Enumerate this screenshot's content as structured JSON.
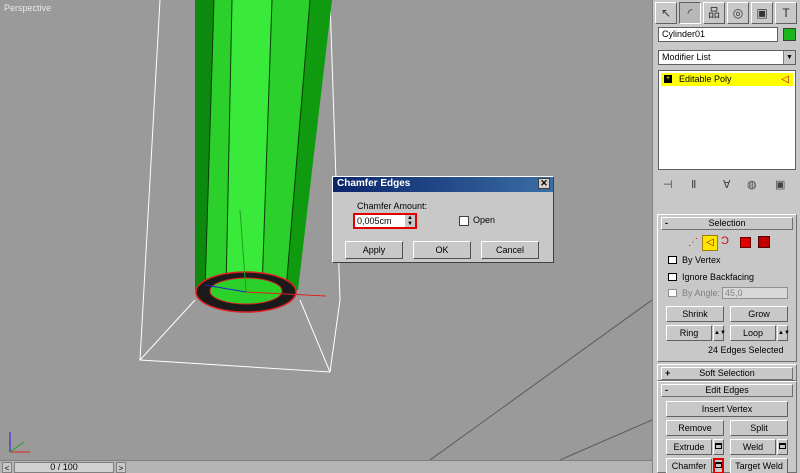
{
  "viewport": {
    "label": "Perspective"
  },
  "timeline": {
    "frame_text": "0 / 100",
    "prev_icon": "<",
    "next_icon": ">"
  },
  "dialog": {
    "title": "Chamfer Edges",
    "close_label": "✕",
    "amount_label": "Chamfer Amount:",
    "amount_value": "0,005cm",
    "open_label": "Open",
    "apply_label": "Apply",
    "ok_label": "OK",
    "cancel_label": "Cancel"
  },
  "panel": {
    "tabs": [
      "↖",
      "◜",
      "品",
      "◎",
      "▣",
      "T"
    ],
    "object_name": "Cylinder01",
    "object_color": "#1ab51a",
    "modifier_list": "Modifier List",
    "stack": [
      {
        "label": "Editable Poly",
        "expander": "+"
      }
    ],
    "stack_tools": [
      "⊣",
      "Ⅱ",
      "∀",
      "◍",
      "▣"
    ],
    "selection": {
      "title": "Selection",
      "sign": "-",
      "by_vertex": "By Vertex",
      "ignore_backfacing": "Ignore Backfacing",
      "by_angle": "By Angle:",
      "angle_value": "45,0",
      "shrink": "Shrink",
      "grow": "Grow",
      "ring": "Ring",
      "loop": "Loop",
      "status": "24 Edges Selected"
    },
    "soft_selection": {
      "title": "Soft Selection",
      "sign": "+"
    },
    "edit_edges": {
      "title": "Edit Edges",
      "sign": "-",
      "insert_vertex": "Insert Vertex",
      "remove": "Remove",
      "split": "Split",
      "extrude": "Extrude",
      "weld": "Weld",
      "chamfer": "Chamfer",
      "target_weld": "Target Weld"
    }
  }
}
